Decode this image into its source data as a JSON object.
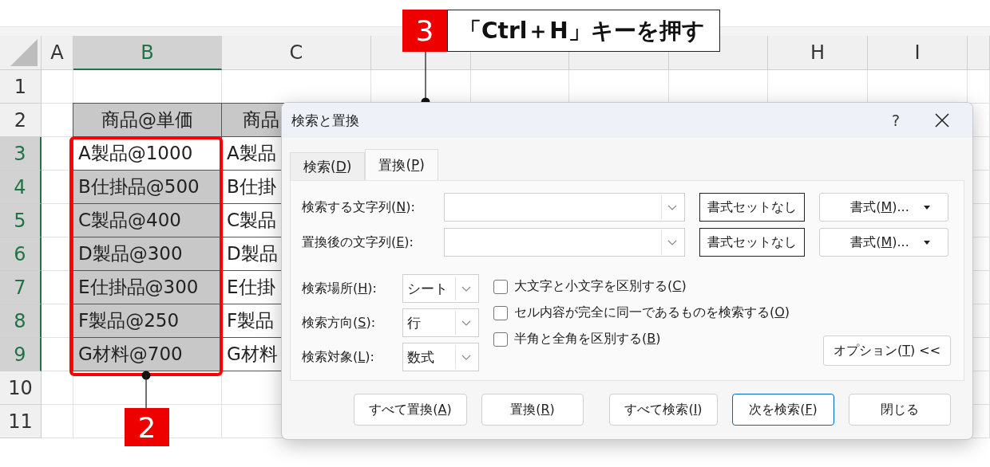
{
  "spreadsheet": {
    "columns": [
      {
        "label": "A",
        "selected": false
      },
      {
        "label": "B",
        "selected": true
      },
      {
        "label": "C",
        "selected": false
      },
      {
        "selected": false
      },
      {
        "selected": false
      },
      {
        "selected": false
      },
      {
        "selected": false
      },
      {
        "label": "H",
        "selected": false
      },
      {
        "label": "I",
        "selected": false
      }
    ],
    "rows": [
      {
        "label": "1",
        "selected": false
      },
      {
        "label": "2",
        "selected": false,
        "b": {
          "text": "商品@単価",
          "kind": "header"
        },
        "c": {
          "text": "商品",
          "kind": "header"
        }
      },
      {
        "label": "3",
        "selected": true,
        "b": {
          "text": "A製品@1000",
          "kind": "item",
          "active": true
        },
        "c": {
          "text": "A製品",
          "kind": "item"
        }
      },
      {
        "label": "4",
        "selected": true,
        "b": {
          "text": "B仕掛品@500",
          "kind": "item",
          "active": false
        },
        "c": {
          "text": "B仕掛",
          "kind": "item"
        }
      },
      {
        "label": "5",
        "selected": true,
        "b": {
          "text": "C製品@400",
          "kind": "item",
          "active": false
        },
        "c": {
          "text": "C製品",
          "kind": "item"
        }
      },
      {
        "label": "6",
        "selected": true,
        "b": {
          "text": "D製品@300",
          "kind": "item",
          "active": false
        },
        "c": {
          "text": "D製品",
          "kind": "item"
        }
      },
      {
        "label": "7",
        "selected": true,
        "b": {
          "text": "E仕掛品@300",
          "kind": "item",
          "active": false
        },
        "c": {
          "text": "E仕掛",
          "kind": "item"
        }
      },
      {
        "label": "8",
        "selected": true,
        "b": {
          "text": "F製品@250",
          "kind": "item",
          "active": false
        },
        "c": {
          "text": "F製品",
          "kind": "item"
        }
      },
      {
        "label": "9",
        "selected": true,
        "b": {
          "text": "G材料@700",
          "kind": "item",
          "active": false
        },
        "c": {
          "text": "G材料",
          "kind": "item"
        }
      },
      {
        "label": "10",
        "selected": false
      },
      {
        "label": "11",
        "selected": false
      }
    ]
  },
  "dialog": {
    "title": "検索と置換",
    "help": "?",
    "tabs": [
      {
        "label": "検索(D)",
        "selected": false
      },
      {
        "label": "置換(P)",
        "selected": true
      }
    ],
    "fields": [
      {
        "label": "検索する文字列(N):",
        "clear_format": "書式セットなし",
        "format": "書式(M)..."
      },
      {
        "label": "置換後の文字列(E):",
        "clear_format": "書式セットなし",
        "format": "書式(M)..."
      }
    ],
    "selects": [
      {
        "label": "検索場所(H):",
        "value": "シート"
      },
      {
        "label": "検索方向(S):",
        "value": "行"
      },
      {
        "label": "検索対象(L):",
        "value": "数式"
      }
    ],
    "checkboxes": [
      {
        "label": "大文字と小文字を区別する(C)",
        "checked": false
      },
      {
        "label": "セル内容が完全に同一であるものを検索する(O)",
        "checked": false
      },
      {
        "label": "半角と全角を区別する(B)",
        "checked": false
      }
    ],
    "options_button": "オプション(T) <<",
    "buttons": [
      {
        "label": "すべて置換(A)",
        "focused": false
      },
      {
        "label": "置換(R)",
        "focused": false
      },
      {
        "label": "すべて検索(I)",
        "focused": false
      },
      {
        "label": "次を検索(F)",
        "focused": true
      },
      {
        "label": "閉じる",
        "focused": false
      }
    ]
  },
  "callouts": [
    {
      "number": "3",
      "text": "「Ctrl＋H」キーを押す"
    },
    {
      "number": "2"
    }
  ]
}
